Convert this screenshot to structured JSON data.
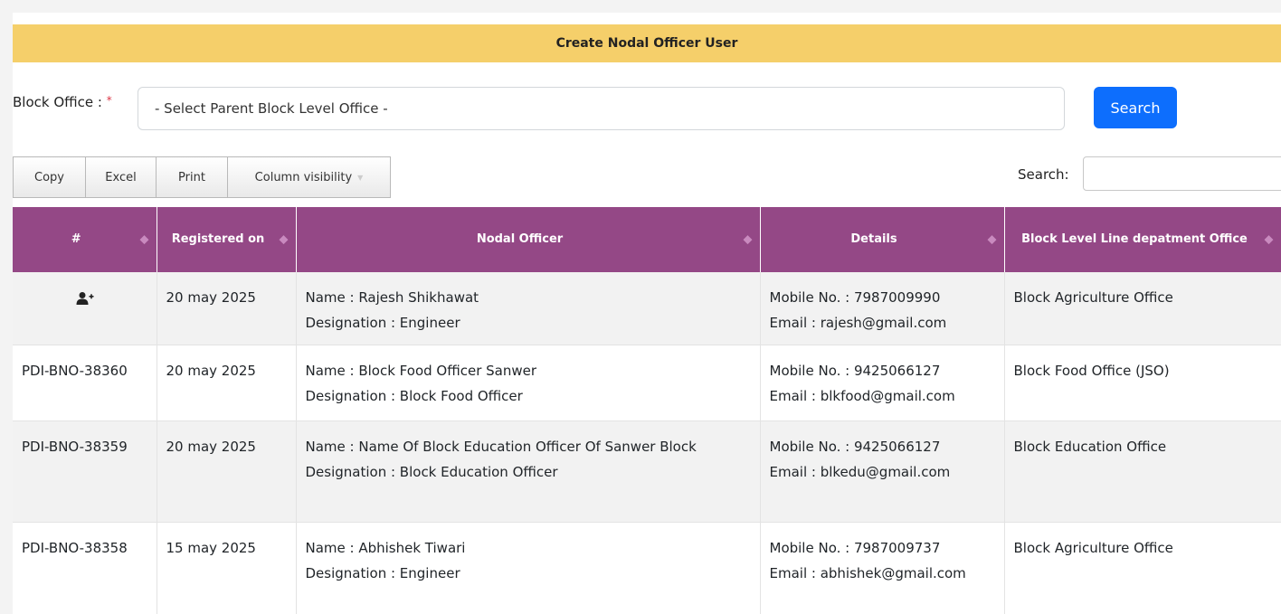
{
  "page": {
    "title": "Create Nodal Officer User"
  },
  "filter": {
    "block_label": "Block Office :",
    "required_mark": "*",
    "block_select_value": "- Select Parent Block Level Office -",
    "search_button": "Search"
  },
  "toolbar": {
    "buttons": [
      "Copy",
      "Excel",
      "Print",
      "Column visibility"
    ],
    "search_label": "Search:",
    "search_value": ""
  },
  "table": {
    "headers": [
      "#",
      "Registered on",
      "Nodal Officer",
      "Details",
      "Block Level Line depatment Office"
    ],
    "rows": [
      {
        "id": "",
        "icon": "add-user-icon",
        "registered": "20 may 2025",
        "name": "Name : Rajesh Shikhawat",
        "designation": "Designation : Engineer",
        "mobile": "Mobile No. : 7987009990",
        "email": "Email : rajesh@gmail.com",
        "office": "Block Agriculture Office"
      },
      {
        "id": "PDI-BNO-38360",
        "registered": "20 may 2025",
        "name": "Name : Block Food Officer Sanwer",
        "designation": "Designation : Block Food Officer",
        "mobile": "Mobile No. : 9425066127",
        "email": "Email : blkfood@gmail.com",
        "office": "Block Food Office (JSO)"
      },
      {
        "id": "PDI-BNO-38359",
        "registered": "20 may 2025",
        "name": "Name : Name Of Block Education Officer Of Sanwer Block",
        "designation": "Designation : Block Education Officer",
        "mobile": "Mobile No. : 9425066127",
        "email": "Email : blkedu@gmail.com",
        "office": "Block Education Office"
      },
      {
        "id": "PDI-BNO-38358",
        "registered": "15 may 2025",
        "name": "Name : Abhishek Tiwari",
        "designation": "Designation : Engineer",
        "mobile": "Mobile No. : 7987009737",
        "email": "Email : abhishek@gmail.com",
        "office": "Block Agriculture Office"
      }
    ]
  },
  "colors": {
    "header_bar": "#f5cf6a",
    "table_header": "#944886",
    "primary_button": "#0d6efd"
  }
}
